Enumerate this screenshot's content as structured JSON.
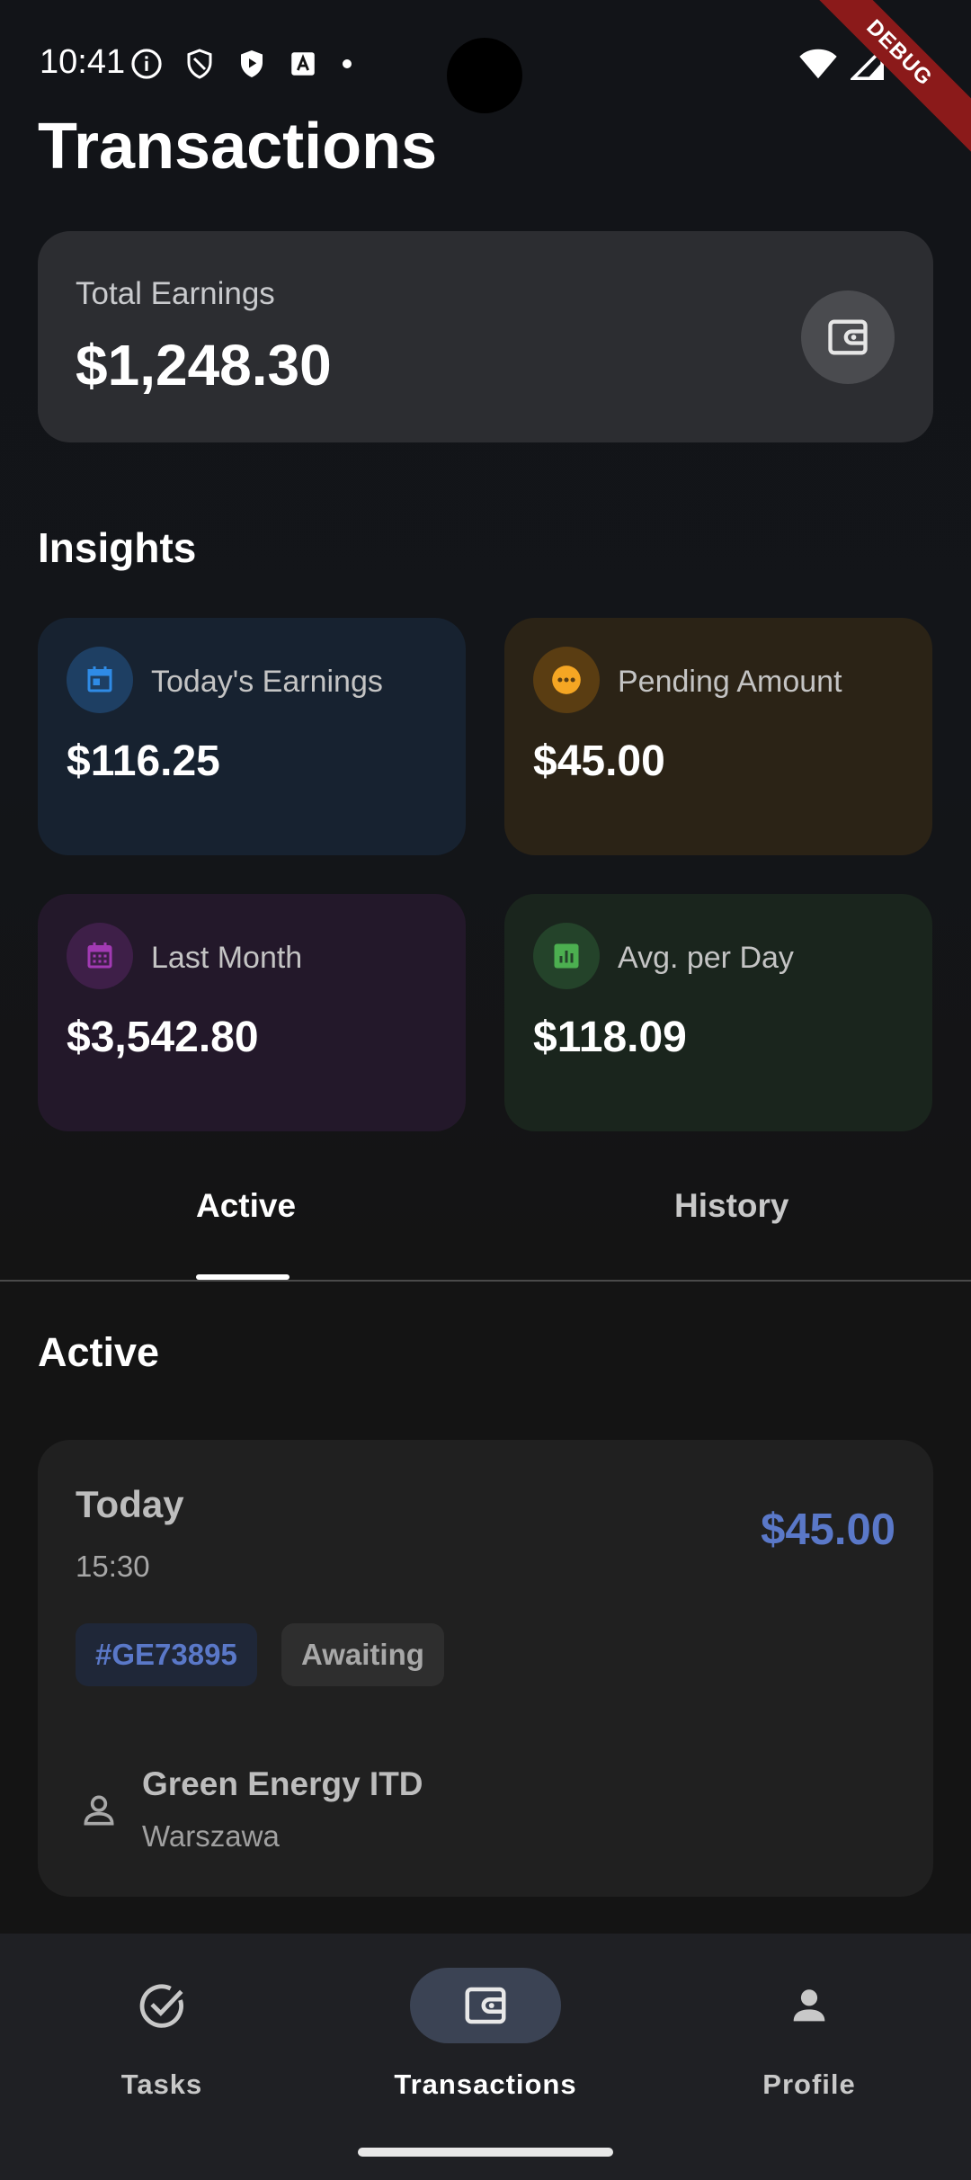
{
  "status_bar": {
    "time": "10:41",
    "debug_label": "DEBUG"
  },
  "header": {
    "title": "Transactions"
  },
  "earnings": {
    "label": "Total Earnings",
    "value": "$1,248.30",
    "icon": "wallet-icon"
  },
  "insights": {
    "title": "Insights",
    "cards": [
      {
        "label": "Today's Earnings",
        "value": "$116.25",
        "icon": "calendar-icon",
        "accent": "#2f8be6",
        "bg": "#172230"
      },
      {
        "label": "Pending Amount",
        "value": "$45.00",
        "icon": "more-horizontal-icon",
        "accent": "#f5a623",
        "bg": "#2b2316"
      },
      {
        "label": "Last Month",
        "value": "$3,542.80",
        "icon": "calendar-month-icon",
        "accent": "#a23ab3",
        "bg": "#23182a"
      },
      {
        "label": "Avg. per Day",
        "value": "$118.09",
        "icon": "bar-chart-icon",
        "accent": "#4caf50",
        "bg": "#1a251d"
      }
    ]
  },
  "tabs": {
    "items": [
      {
        "label": "Active",
        "selected": true
      },
      {
        "label": "History",
        "selected": false
      }
    ]
  },
  "active_section": {
    "title": "Active"
  },
  "transaction": {
    "date": "Today",
    "time": "15:30",
    "amount": "$45.00",
    "id_tag": "#GE73895",
    "status_tag": "Awaiting",
    "company": "Green Energy ITD",
    "city": "Warszawa"
  },
  "bottom_nav": {
    "items": [
      {
        "label": "Tasks",
        "icon": "check-circle-icon",
        "selected": false
      },
      {
        "label": "Transactions",
        "icon": "wallet-icon",
        "selected": true
      },
      {
        "label": "Profile",
        "icon": "person-icon",
        "selected": false
      }
    ]
  },
  "colors": {
    "accent_blue": "#5a78c8",
    "nav_active_pill": "#3b4354"
  }
}
